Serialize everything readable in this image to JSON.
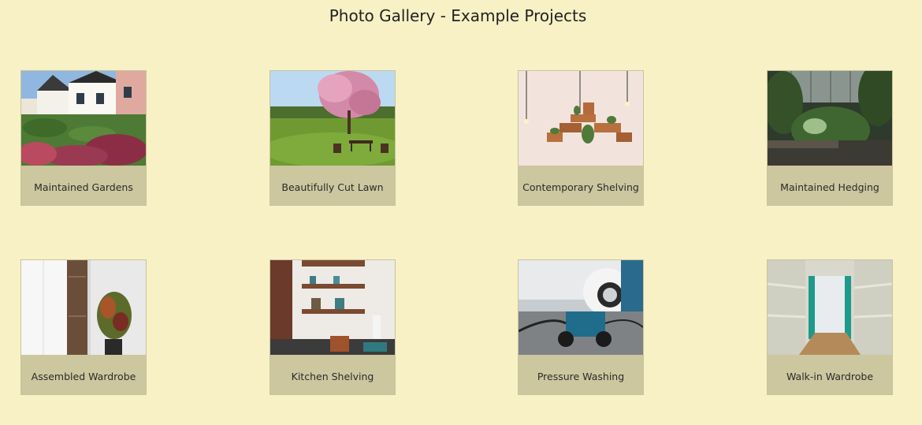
{
  "page": {
    "title": "Photo Gallery - Example Projects"
  },
  "gallery": {
    "items": [
      {
        "caption": "Maintained Gardens",
        "image": "garden-houses-photo"
      },
      {
        "caption": "Beautifully Cut Lawn",
        "image": "lawn-blossom-tree-photo"
      },
      {
        "caption": "Contemporary Shelving",
        "image": "wall-shelves-photo"
      },
      {
        "caption": "Maintained Hedging",
        "image": "hedge-garden-photo"
      },
      {
        "caption": "Assembled Wardrobe",
        "image": "wardrobe-plant-photo"
      },
      {
        "caption": "Kitchen Shelving",
        "image": "kitchen-shelves-photo"
      },
      {
        "caption": "Pressure Washing",
        "image": "pressure-washer-photo"
      },
      {
        "caption": "Walk-in Wardrobe",
        "image": "walk-in-wardrobe-photo"
      }
    ]
  }
}
